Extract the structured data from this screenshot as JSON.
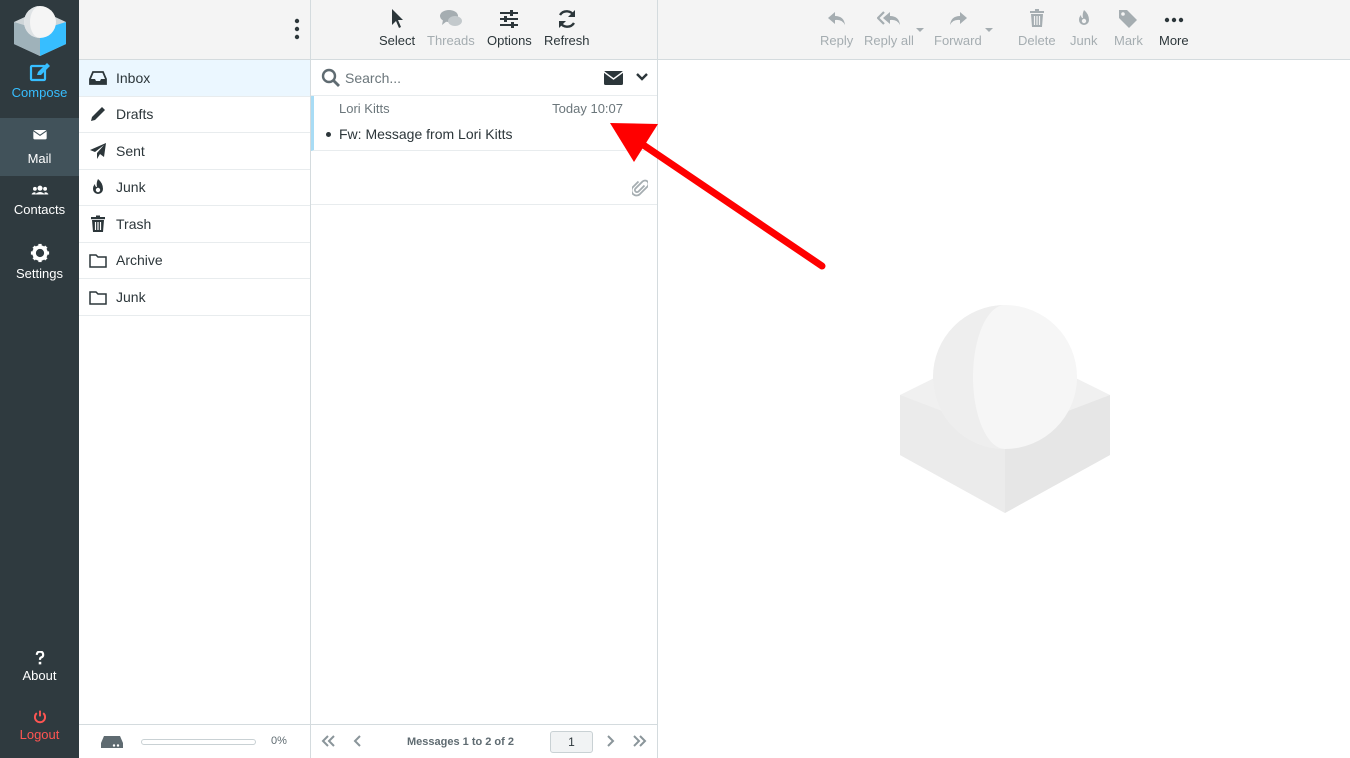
{
  "nav": {
    "compose": "Compose",
    "mail": "Mail",
    "contacts": "Contacts",
    "settings": "Settings",
    "about": "About",
    "logout": "Logout"
  },
  "folders": [
    {
      "label": "Inbox",
      "icon": "inbox-icon"
    },
    {
      "label": "Drafts",
      "icon": "pencil-icon"
    },
    {
      "label": "Sent",
      "icon": "paper-plane-icon"
    },
    {
      "label": "Junk",
      "icon": "fire-icon"
    },
    {
      "label": "Trash",
      "icon": "trash-icon"
    },
    {
      "label": "Archive",
      "icon": "folder-icon"
    },
    {
      "label": "Junk",
      "icon": "folder-icon"
    }
  ],
  "quota": {
    "percent_text": "0%",
    "fraction": 0.0
  },
  "list_toolbar": {
    "select": "Select",
    "threads": "Threads",
    "options": "Options",
    "refresh": "Refresh"
  },
  "search": {
    "placeholder": "Search..."
  },
  "messages": [
    {
      "from": "Lori Kitts",
      "date": "Today 10:07",
      "subject": "Fw: Message from Lori Kitts"
    }
  ],
  "list_footer": {
    "count": "Messages 1 to 2 of 2",
    "page": "1"
  },
  "content_toolbar": {
    "reply": "Reply",
    "reply_all": "Reply all",
    "forward": "Forward",
    "delete": "Delete",
    "junk": "Junk",
    "mark": "Mark",
    "more": "More"
  },
  "colors": {
    "nav_bg": "#2f3a3f",
    "accent": "#37beff",
    "logout": "#ff5552",
    "annotation_arrow": "#ff0000"
  }
}
